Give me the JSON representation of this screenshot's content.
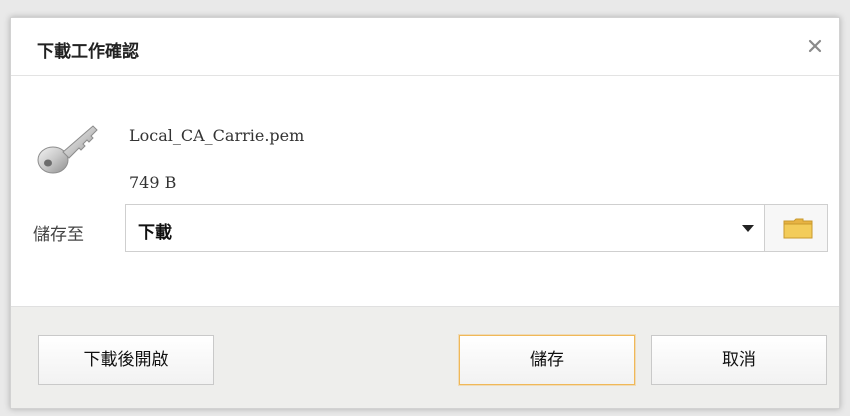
{
  "dialog": {
    "title": "下載工作確認",
    "close_icon": "close-icon"
  },
  "file": {
    "icon": "key-icon",
    "name": "Local_CA_Carrie.pem",
    "size": "749 B"
  },
  "save_to": {
    "label": "儲存至",
    "selected": "下載",
    "folder_icon": "folder-icon"
  },
  "footer": {
    "open_after_label": "下載後開啟",
    "save_label": "儲存",
    "cancel_label": "取消"
  },
  "colors": {
    "accent_border": "#f0b858",
    "footer_bg": "#eeeeec",
    "folder_yellow": "#f3cc5a"
  }
}
